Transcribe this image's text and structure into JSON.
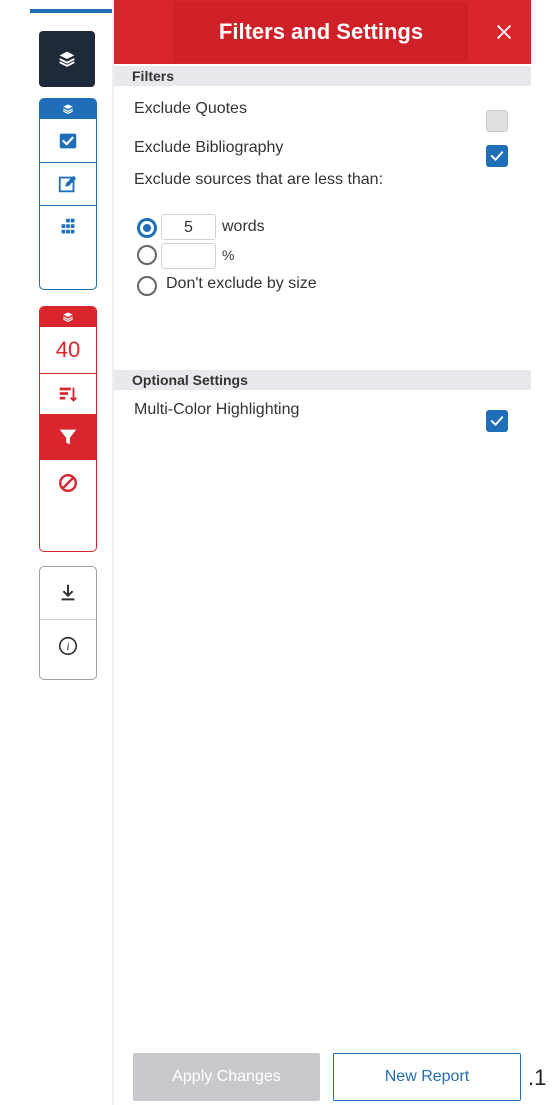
{
  "header": {
    "title": "Filters and Settings",
    "close_icon": "close-icon"
  },
  "sidebar": {
    "layers_main_icon": "layers-icon",
    "blue_group": [
      "layers-icon",
      "checkbox-icon",
      "edit-icon",
      "grid-icon"
    ],
    "red_group": {
      "cap_icon": "layers-icon",
      "count": "40",
      "icons": [
        "sort-icon",
        "filter-icon",
        "block-icon"
      ]
    },
    "gray_group": [
      "download-icon",
      "info-icon"
    ]
  },
  "filters": {
    "section_label": "Filters",
    "exclude_quotes": {
      "label": "Exclude Quotes",
      "checked": false
    },
    "exclude_bibliography": {
      "label": "Exclude Bibliography",
      "checked": true
    },
    "exclude_size_label": "Exclude sources that are less than:",
    "size_options": [
      {
        "value": "5",
        "unit": "words",
        "selected": true
      },
      {
        "value": "",
        "unit": "%",
        "selected": false
      },
      {
        "label": "Don't exclude by size",
        "selected": false
      }
    ]
  },
  "optional": {
    "section_label": "Optional Settings",
    "multi_color": {
      "label": "Multi-Color Highlighting",
      "checked": true
    }
  },
  "footer": {
    "apply_label": "Apply Changes",
    "new_report_label": "New Report",
    "page_fragment": ".1"
  },
  "colors": {
    "accent_blue": "#1f6eb8",
    "accent_red": "#d9262e",
    "dark": "#1e2a3a"
  }
}
